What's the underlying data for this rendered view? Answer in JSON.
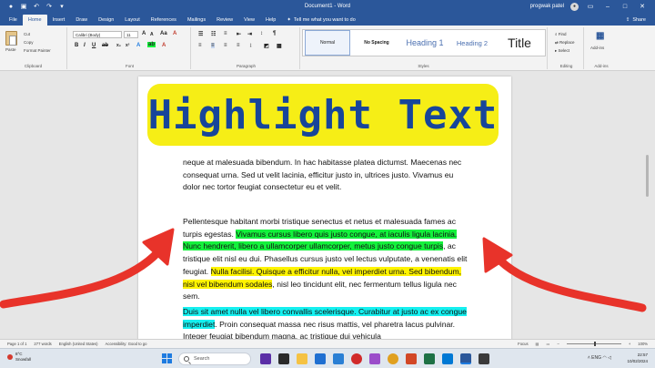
{
  "titlebar": {
    "title": "Document1 - Word",
    "user": "progwak patel"
  },
  "tabs": [
    "File",
    "Home",
    "Insert",
    "Draw",
    "Design",
    "Layout",
    "References",
    "Mailings",
    "Review",
    "View",
    "Help"
  ],
  "tell_me": "Tell me what you want to do",
  "share_label": "Share",
  "ribbon": {
    "clipboard": {
      "paste": "Paste",
      "cut": "Cut",
      "copy": "Copy",
      "format_painter": "Format Painter",
      "label": "Clipboard"
    },
    "font": {
      "name": "Calibri (Body)",
      "size": "11",
      "label": "Font"
    },
    "paragraph": {
      "label": "Paragraph"
    },
    "styles": {
      "items": [
        "Normal",
        "No Spacing",
        "Heading 1",
        "Heading 2",
        "Title"
      ],
      "label": "Styles"
    },
    "editing": {
      "find": "Find",
      "replace": "Replace",
      "select": "Select",
      "label": "Editing"
    },
    "addins": {
      "button": "Add-ins",
      "label": "Add-ins"
    }
  },
  "banner": {
    "text": "Highlight Text"
  },
  "doc": {
    "p1": "neque at malesuada bibendum. In hac habitasse platea dictumst. Maecenas nec consequat urna. Sed ut velit lacinia, efficitur justo in, ultrices justo. Vivamus eu dolor nec tortor feugiat consectetur eu et velit.",
    "p2_a": "Pellentesque habitant morbi tristique senectus et netus et malesuada fames ac turpis egestas. ",
    "p2_green": "Vivamus cursus libero quis justo congue, at iaculis ligula lacinia. Nunc hendrerit, libero a ullamcorper ullamcorper, metus justo congue turpis",
    "p2_b": ", ac tristique elit nisl eu dui. Phasellus cursus justo vel lectus vulputate, a venenatis elit feugiat. ",
    "p2_yellow": "Nulla facilisi. Quisque a efficitur nulla, vel imperdiet urna. Sed bibendum, nisl vel bibendum sodales",
    "p2_c": ", nisl leo tincidunt elit, nec fermentum tellus ligula nec sem.",
    "p3_cyan": "Duis sit amet nulla vel libero convallis scelerisque. Curabitur at justo ac ex congue imperdiet",
    "p3_a": ". Proin consequat massa nec risus mattis, vel pharetra lacus pulvinar. Integer feugiat bibendum magna, ac tristique dui vehicula"
  },
  "status": {
    "page": "Page 1 of 1",
    "words": "277 words",
    "lang": "English (United States)",
    "accessibility": "Accessibility: Good to go",
    "focus": "Focus",
    "zoom": "100%"
  },
  "taskbar": {
    "weather_temp": "8°C",
    "weather_desc": "Snowfall",
    "search": "Search",
    "lang": "ENG",
    "time": "22:57",
    "date": "10/02/2024"
  },
  "colors": {
    "word_blue": "#2b579a",
    "banner_yellow": "#f6ee16",
    "banner_text": "#17459a",
    "hl_green": "#14f13c",
    "hl_yellow": "#fef300",
    "hl_cyan": "#15f0f0",
    "arrow_red": "#e8332a"
  }
}
